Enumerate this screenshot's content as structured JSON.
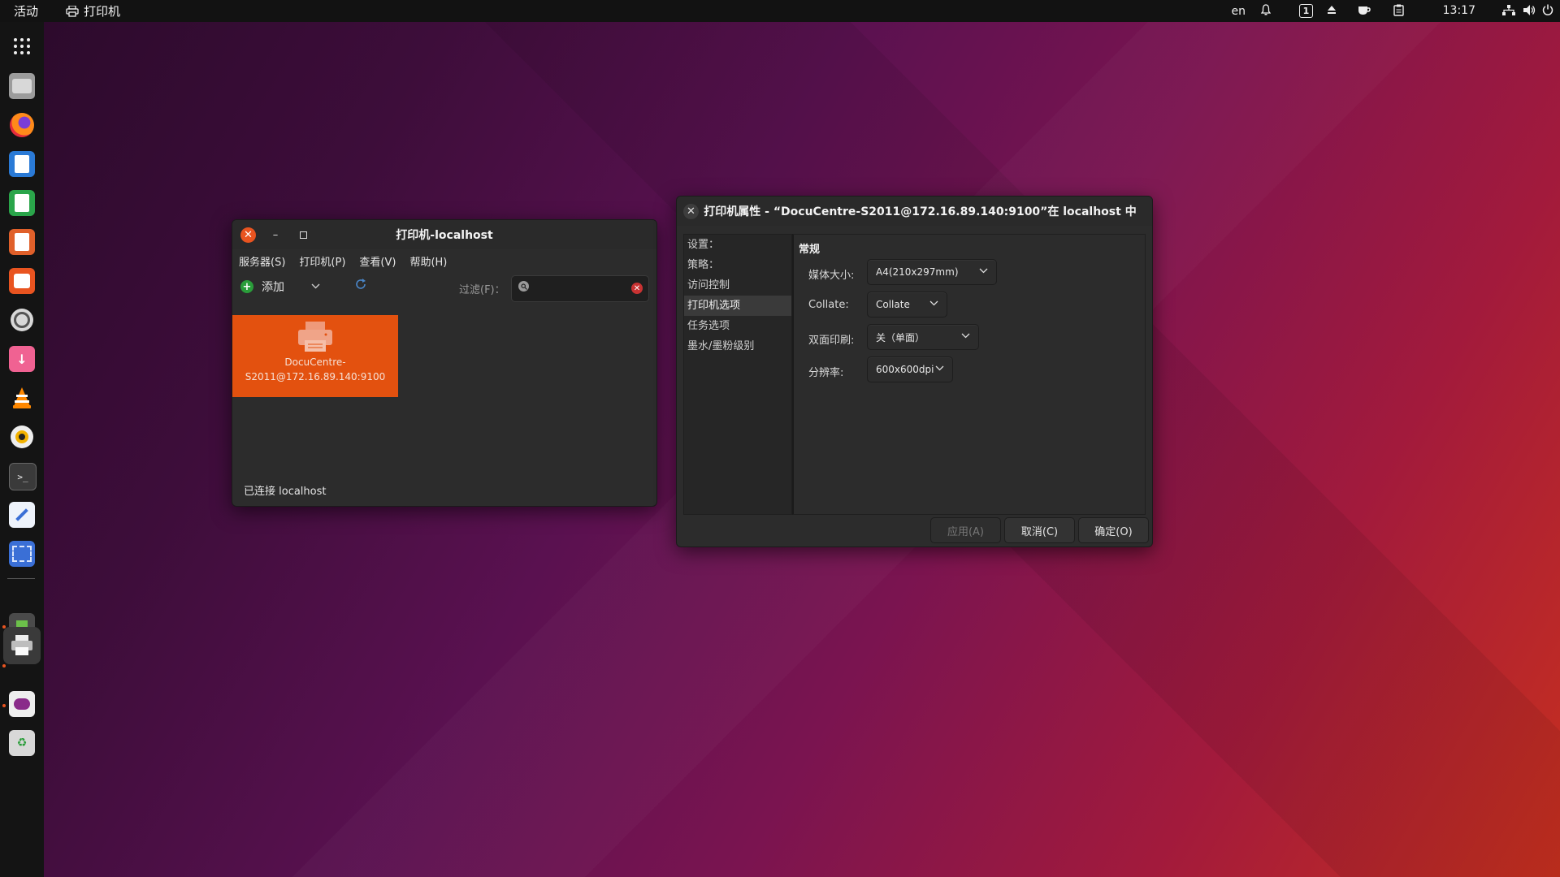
{
  "topbar": {
    "activities": "活动",
    "app_name": "打印机",
    "lang": "en",
    "workspace": "1",
    "time": "13:17"
  },
  "dock": {
    "items": [
      "apps-grid-icon",
      "files-icon",
      "firefox-icon",
      "writer-icon",
      "calc-icon",
      "impress-icon",
      "software-icon",
      "settings-icon",
      "installer-icon",
      "vlc-icon",
      "rhythmbox-icon",
      "terminal-icon",
      "text-editor-icon",
      "screenshot-icon",
      "extension-icon",
      "printers-icon",
      "tweaks-icon",
      "trash-icon"
    ]
  },
  "printers_window": {
    "title": "打印机-localhost",
    "menu": [
      "服务器(S)",
      "打印机(P)",
      "查看(V)",
      "帮助(H)"
    ],
    "add_label": "添加",
    "filter_label": "过滤(F)：",
    "filter_value": "",
    "printer_name_line1": "DocuCentre-",
    "printer_name_line2": "S2011@172.16.89.140:9100",
    "status": "已连接 localhost"
  },
  "props_window": {
    "title": "打印机属性 - “DocuCentre-S2011@172.16.89.140:9100”在 localhost 中",
    "sidebar": [
      "设置：",
      "策略：",
      "访问控制",
      "打印机选项",
      "任务选项",
      "墨水/墨粉级别"
    ],
    "selected_index": 3,
    "section_heading": "常规",
    "options": [
      {
        "label": "媒体大小:",
        "value": "A4(210x297mm)"
      },
      {
        "label": "Collate:",
        "value": "Collate"
      },
      {
        "label": "双面印刷:",
        "value": "关（单面）"
      },
      {
        "label": "分辨率:",
        "value": "600x600dpi"
      }
    ],
    "buttons": {
      "apply": "应用(A)",
      "cancel": "取消(C)",
      "ok": "确定(O)"
    }
  },
  "colors": {
    "accent": "#e95420",
    "printer_tile": "#e3510f"
  }
}
